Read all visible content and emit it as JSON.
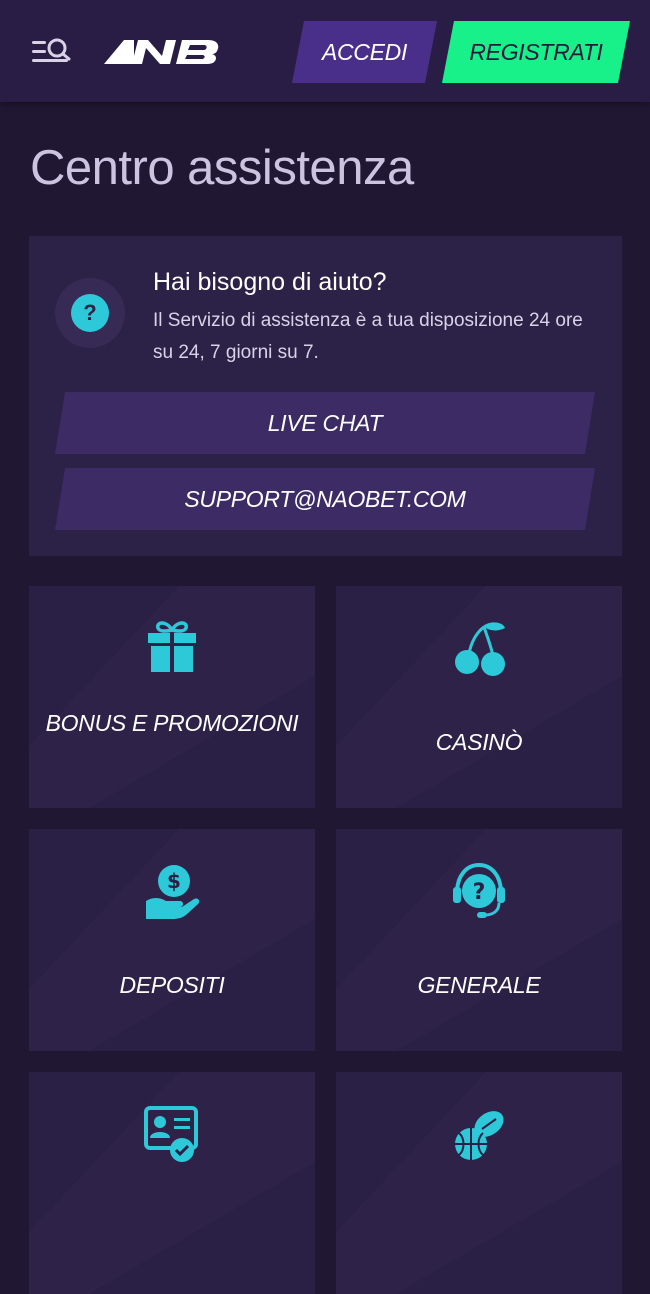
{
  "header": {
    "login_label": "ACCEDI",
    "register_label": "REGISTRATI",
    "colors": {
      "background": "#2a1d45",
      "login": "#4a2f8a",
      "register": "#18f08a"
    }
  },
  "page": {
    "title": "Centro assistenza"
  },
  "help_card": {
    "title": "Hai bisogno di aiuto?",
    "description": "Il Servizio di assistenza è a tua disposizione 24 ore su 24, 7 giorni su 7.",
    "icon_glyph": "?",
    "icon": "question-icon",
    "live_chat_label": "LIVE CHAT",
    "email_label": "SUPPORT@NAOBET.COM"
  },
  "categories": [
    {
      "label": "BONUS E PROMOZIONI",
      "icon": "gift-icon"
    },
    {
      "label": "CASINÒ",
      "icon": "cherries-icon"
    },
    {
      "label": "DEPOSITI",
      "icon": "money-hand-icon"
    },
    {
      "label": "GENERALE",
      "icon": "headset-question-icon"
    },
    {
      "label": "",
      "icon": "id-card-check-icon"
    },
    {
      "label": "",
      "icon": "sports-balls-icon"
    }
  ],
  "accent_color": "#2ec9d9"
}
